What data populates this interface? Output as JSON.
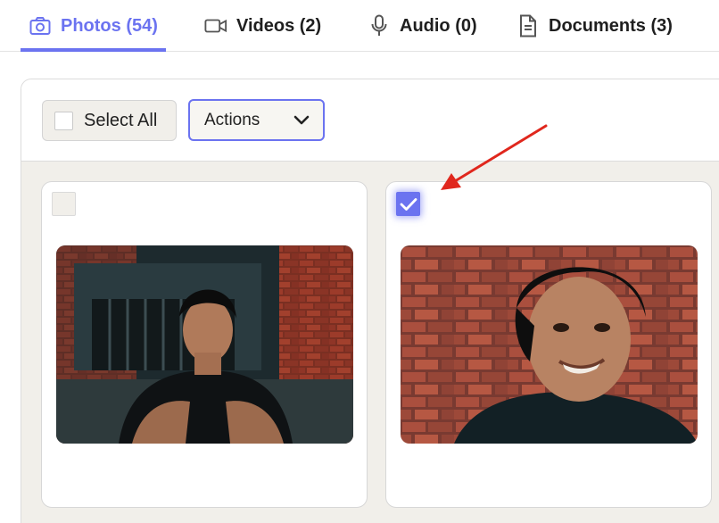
{
  "tabs": [
    {
      "label": "Photos (54)",
      "icon": "camera-icon",
      "active": true
    },
    {
      "label": "Videos (2)",
      "icon": "video-camera-icon",
      "active": false
    },
    {
      "label": "Audio (0)",
      "icon": "microphone-icon",
      "active": false
    },
    {
      "label": "Documents (3)",
      "icon": "document-icon",
      "active": false
    }
  ],
  "toolbar": {
    "select_all_label": "Select All",
    "actions_label": "Actions"
  },
  "photos": [
    {
      "selected": false
    },
    {
      "selected": true
    }
  ],
  "colors": {
    "accent": "#6b73f0",
    "annotation_arrow": "#e0271d",
    "panel_bg": "#f1efea"
  }
}
